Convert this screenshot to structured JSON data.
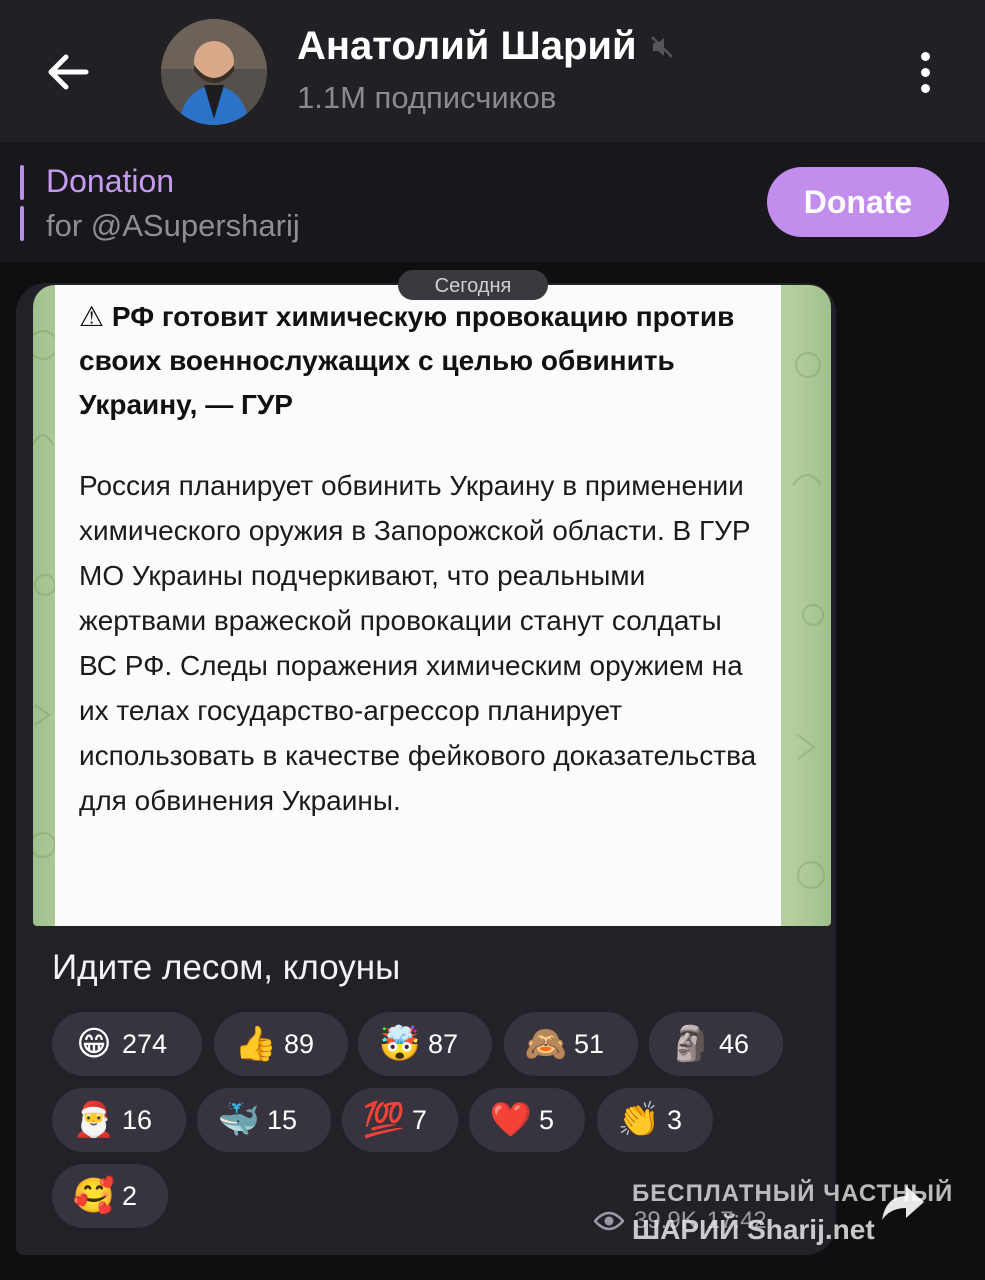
{
  "header": {
    "channel_name": "Анатолий Шарий",
    "subscribers": "1.1M подписчиков"
  },
  "pinned": {
    "title": "Donation",
    "subtitle": "for @ASupersharij",
    "button": "Donate"
  },
  "date_pill": "Сегодня",
  "post": {
    "image_headline": "⚠ РФ готовит химическую провокацию против своих военнослужащих с целью обвинить Украину, — ГУР",
    "image_body": "Россия планирует обвинить Украину в применении химического оружия в Запорожской области. В ГУР МО Украины подчеркивают, что реальными жертвами вражеской провокации станут солдаты ВС РФ. Следы поражения химическим оружием на их телах государство-агрессор планирует использовать в качестве фейкового доказательства для обвинения Украины.",
    "caption": "Идите лесом, клоуны",
    "views": "39.9K",
    "time": "17:42"
  },
  "reactions": [
    {
      "emoji": "😁",
      "count": "274"
    },
    {
      "emoji": "👍",
      "count": "89"
    },
    {
      "emoji": "🤯",
      "count": "87"
    },
    {
      "emoji": "🙈",
      "count": "51"
    },
    {
      "emoji": "🗿",
      "count": "46"
    },
    {
      "emoji": "🎅",
      "count": "16"
    },
    {
      "emoji": "🐳",
      "count": "15"
    },
    {
      "emoji": "💯",
      "count": "7"
    },
    {
      "emoji": "❤️",
      "count": "5"
    },
    {
      "emoji": "👏",
      "count": "3"
    },
    {
      "emoji": "🥰",
      "count": "2"
    }
  ],
  "watermark": {
    "line1": "БЕСПЛАТНЫЙ ЧАСТНЫЙ",
    "line2": "ШАРИЙ Sharij.net"
  },
  "colors": {
    "header_bg": "#212024",
    "accent_purple": "#c38ded",
    "bubble_bg": "#232128",
    "reaction_bg": "#38343f"
  }
}
